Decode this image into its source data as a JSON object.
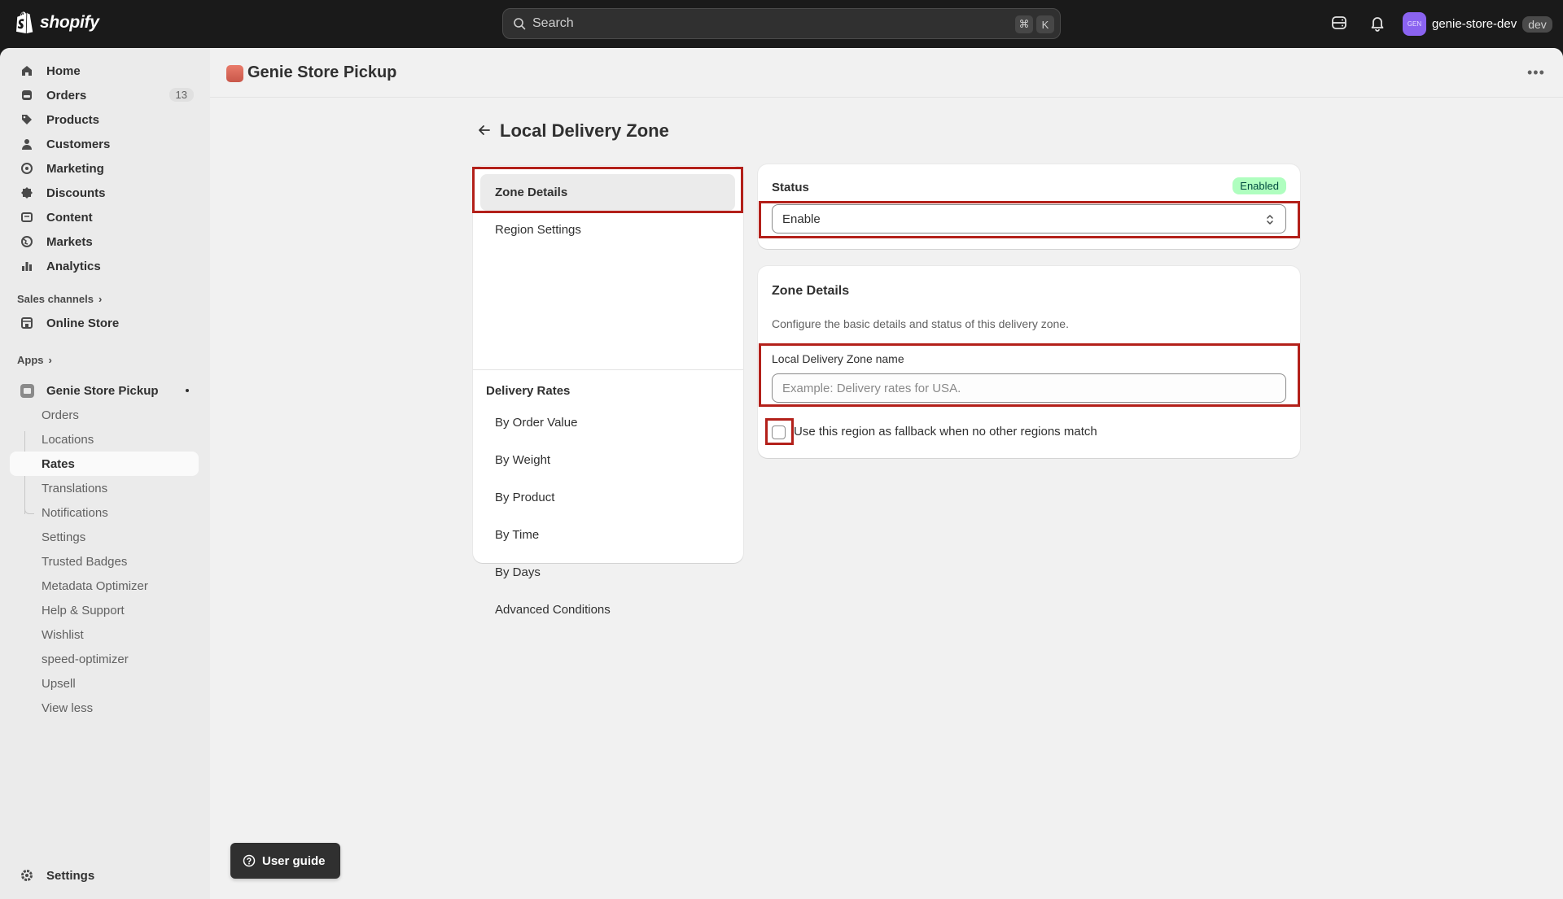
{
  "topbar": {
    "brand": "shopify",
    "search_placeholder": "Search",
    "shortcut_key_1": "⌘",
    "shortcut_key_2": "K",
    "avatar_initials": "GEN",
    "store_name": "genie-store-dev",
    "store_badge": "dev"
  },
  "sidebar": {
    "main_items": [
      {
        "label": "Home",
        "icon": "home-icon"
      },
      {
        "label": "Orders",
        "icon": "orders-icon",
        "count": "13"
      },
      {
        "label": "Products",
        "icon": "tag-icon"
      },
      {
        "label": "Customers",
        "icon": "person-icon"
      },
      {
        "label": "Marketing",
        "icon": "target-icon"
      },
      {
        "label": "Discounts",
        "icon": "discount-icon"
      },
      {
        "label": "Content",
        "icon": "content-icon"
      },
      {
        "label": "Markets",
        "icon": "globe-icon"
      },
      {
        "label": "Analytics",
        "icon": "bar-chart-icon"
      }
    ],
    "sales_channels_label": "Sales channels",
    "online_store_label": "Online Store",
    "apps_label": "Apps",
    "app_name": "Genie Store Pickup",
    "app_sub_items": [
      "Orders",
      "Locations",
      "Rates",
      "Translations",
      "Notifications",
      "Settings",
      "Trusted Badges",
      "Metadata Optimizer",
      "Help & Support",
      "Wishlist",
      "speed-optimizer",
      "Upsell",
      "View less"
    ],
    "active_sub_item": "Rates",
    "settings_label": "Settings"
  },
  "page": {
    "app_title": "Genie Store Pickup",
    "title": "Local Delivery Zone"
  },
  "section_nav": {
    "items_top": [
      "Zone Details",
      "Region Settings"
    ],
    "selected": "Zone Details",
    "group_label": "Delivery Rates",
    "items_rates": [
      "By Order Value",
      "By Weight",
      "By Product",
      "By Time",
      "By Days",
      "Advanced Conditions"
    ]
  },
  "status_card": {
    "label": "Status",
    "badge": "Enabled",
    "badge_color": "#affebf",
    "select_value": "Enable"
  },
  "details_card": {
    "title": "Zone Details",
    "description": "Configure the basic details and status of this delivery zone.",
    "name_label": "Local Delivery Zone name",
    "name_value": "",
    "name_placeholder": "Example: Delivery rates for USA.",
    "fallback_label": "Use this region as fallback when no other regions match",
    "fallback_checked": false
  },
  "user_guide_label": "User guide",
  "annotation_color": "#b3201a"
}
